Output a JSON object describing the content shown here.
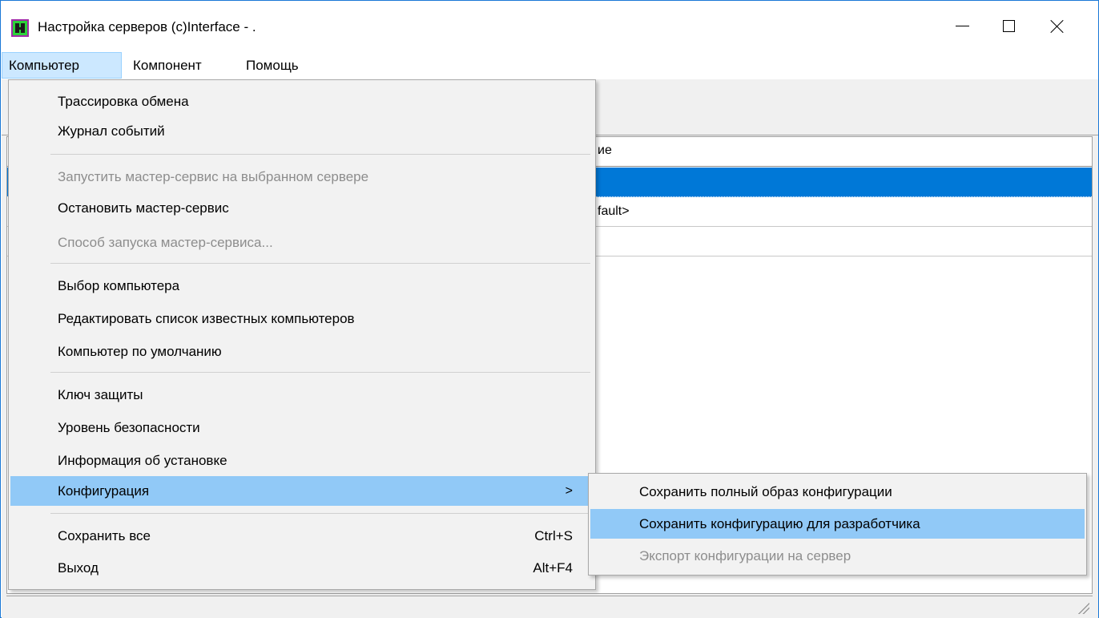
{
  "window": {
    "title": "Настройка серверов (c)Interface - ."
  },
  "menubar": {
    "items": [
      {
        "label": "Компьютер"
      },
      {
        "label": "Компонент"
      },
      {
        "label": "Помощь"
      }
    ]
  },
  "list": {
    "header_fragment": "ие",
    "rows": [
      {
        "text": ""
      },
      {
        "text": "fault>"
      },
      {
        "text": ""
      }
    ]
  },
  "computer_menu": {
    "items": [
      {
        "label": "Трассировка обмена",
        "enabled": true
      },
      {
        "label": "Журнал событий",
        "enabled": true
      },
      {
        "label": "Запустить мастер-сервис на выбранном сервере",
        "enabled": false
      },
      {
        "label": "Остановить мастер-сервис",
        "enabled": true
      },
      {
        "label": "Способ запуска мастер-сервиса...",
        "enabled": false
      },
      {
        "label": "Выбор компьютера",
        "enabled": true
      },
      {
        "label": "Редактировать список известных компьютеров",
        "enabled": true
      },
      {
        "label": "Компьютер по умолчанию",
        "enabled": true
      },
      {
        "label": "Ключ защиты",
        "enabled": true
      },
      {
        "label": "Уровень безопасности",
        "enabled": true
      },
      {
        "label": "Информация об установке",
        "enabled": true
      },
      {
        "label": "Конфигурация",
        "enabled": true,
        "submenu_arrow": ">",
        "highlighted": true
      },
      {
        "label": "Сохранить все",
        "enabled": true,
        "shortcut": "Ctrl+S"
      },
      {
        "label": "Выход",
        "enabled": true,
        "shortcut": "Alt+F4"
      }
    ]
  },
  "config_submenu": {
    "items": [
      {
        "label": "Сохранить полный образ конфигурации",
        "enabled": true
      },
      {
        "label": "Сохранить конфигурацию для разработчика",
        "enabled": true,
        "highlighted": true
      },
      {
        "label": "Экспорт конфигурации на сервер",
        "enabled": false
      }
    ]
  },
  "colors": {
    "menu_highlight": "#91c9f7",
    "selected_row": "#0078d7",
    "menubar_active": "#cce8ff",
    "disabled_text": "#8d8d8d"
  },
  "icons": {
    "app": "app-icon",
    "minimize": "minimize-icon",
    "maximize": "maximize-icon",
    "close": "close-icon",
    "submenu": "chevron-right-icon",
    "resize": "resize-grip-icon"
  }
}
